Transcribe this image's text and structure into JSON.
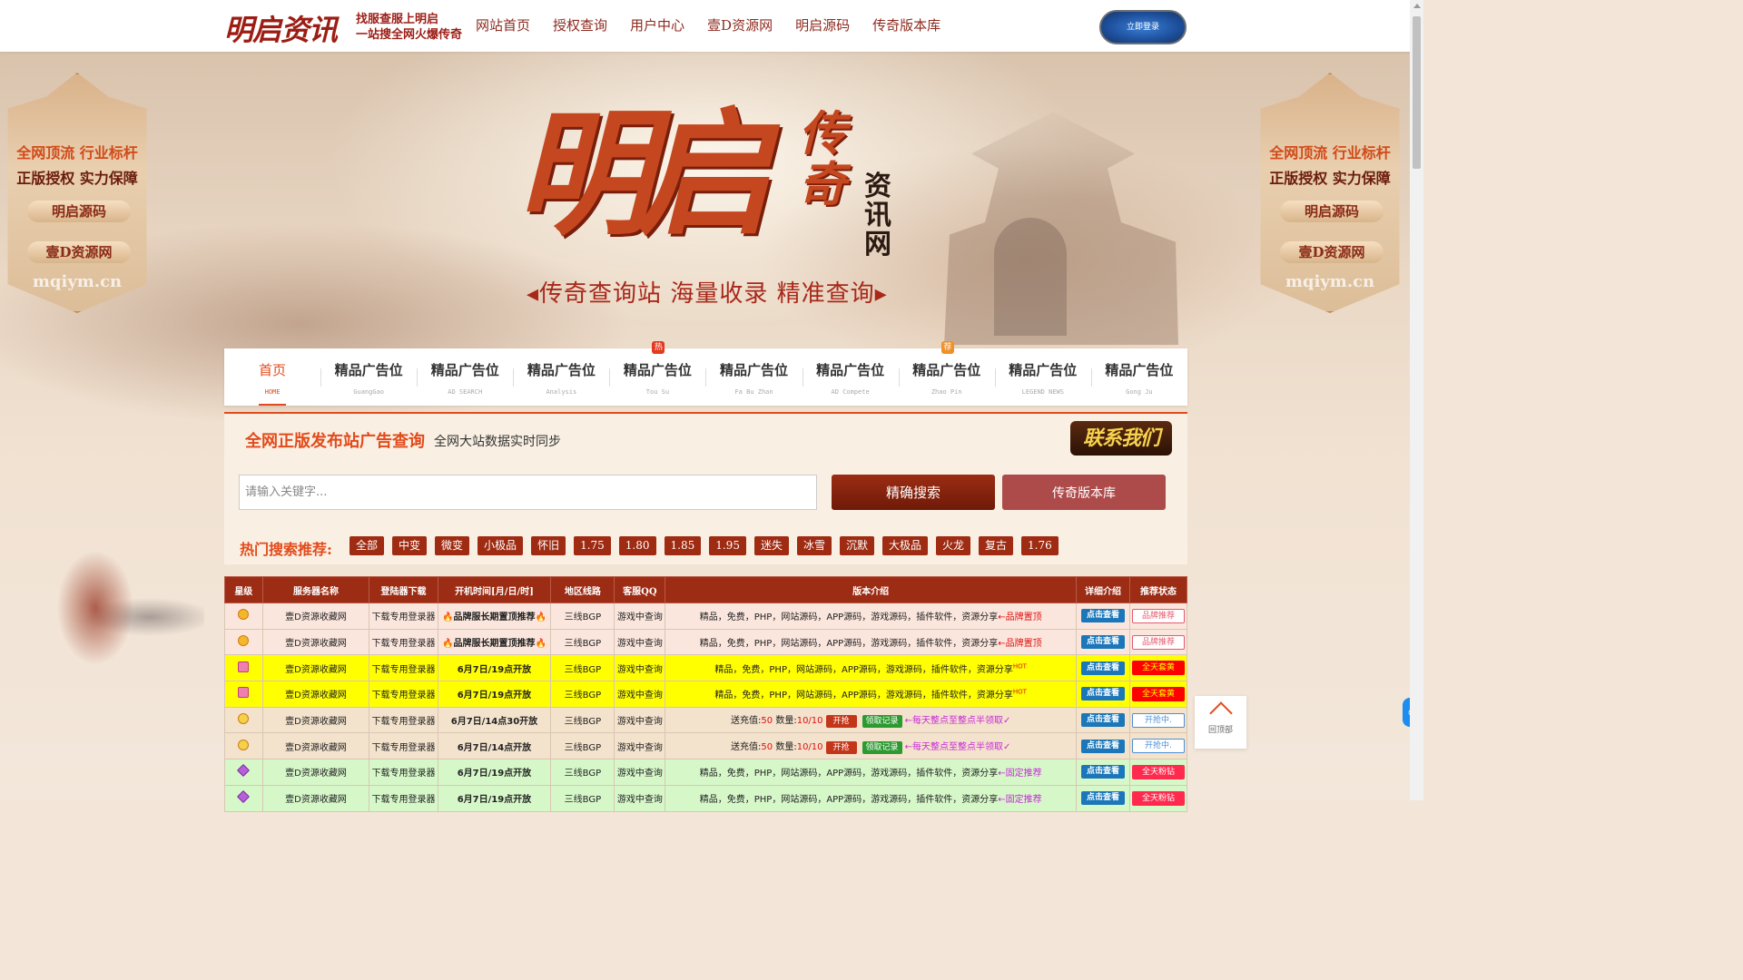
{
  "header": {
    "logo": "明启资讯",
    "tagline1": "找服查服上明启",
    "tagline2": "一站搜全网火爆传奇",
    "nav": [
      "网站首页",
      "授权查询",
      "用户中心",
      "壹D资源网",
      "明启源码",
      "传奇版本库"
    ],
    "login_label": "立即登录"
  },
  "side_banner": {
    "line1": "全网顶流 行业标杆",
    "line2": "正版授权 实力保障",
    "pill1": "明启源码",
    "pill2": "壹D资源网",
    "url": "mqiym.cn"
  },
  "hero": {
    "title": "明启",
    "title2": "传奇",
    "title3": "资讯网",
    "slogan": "◂传奇查询站 海量收录 精准查询▸"
  },
  "categories": [
    {
      "label": "首页",
      "sub": "HOME",
      "active": true,
      "badge": ""
    },
    {
      "label": "精品广告位",
      "sub": "GuangGao",
      "badge": ""
    },
    {
      "label": "精品广告位",
      "sub": "AD SEARCH",
      "badge": ""
    },
    {
      "label": "精品广告位",
      "sub": "Analysis",
      "badge": ""
    },
    {
      "label": "精品广告位",
      "sub": "Tou Su",
      "badge": "热"
    },
    {
      "label": "精品广告位",
      "sub": "Fa Bu Zhan",
      "badge": ""
    },
    {
      "label": "精品广告位",
      "sub": "AD Compete",
      "badge": ""
    },
    {
      "label": "精品广告位",
      "sub": "Zhao Pin",
      "badge": "荐"
    },
    {
      "label": "精品广告位",
      "sub": "LEGEND NEWS",
      "badge": ""
    },
    {
      "label": "精品广告位",
      "sub": "Gong Ju",
      "badge": ""
    }
  ],
  "search": {
    "title": "全网正版发布站广告查询",
    "subtitle": "全网大站数据实时同步",
    "contact_label": "联系我们",
    "placeholder": "请输入关键字...",
    "search_label": "精确搜索",
    "library_label": "传奇版本库",
    "hot_label": "热门搜索推荐:",
    "hot_tags": [
      "全部",
      "中变",
      "微变",
      "小极品",
      "怀旧",
      "1.75",
      "1.80",
      "1.85",
      "1.95",
      "迷失",
      "冰雪",
      "沉默",
      "大极品",
      "火龙",
      "复古",
      "1.76"
    ]
  },
  "table": {
    "headers": [
      "星级",
      "服务器名称",
      "登陆器下载",
      "开机时间[月/日/时]",
      "地区线路",
      "客服QQ",
      "版本介绍",
      "详细介绍",
      "推荐状态"
    ],
    "rows": [
      {
        "style": "pink",
        "icon": "sun",
        "name": "壹D资源收藏网",
        "download": "下载专用登录器",
        "time": "🔥品牌服长期置顶推荐🔥",
        "time_style": "brand-red",
        "line": "三线BGP",
        "qq": "游戏中查询",
        "intro": "精品，免费，PHP，网站源码，APP源码，游戏源码，插件软件，资源分享",
        "tail": "←品牌置顶",
        "tail_style": "tail-red",
        "view": "点击查看",
        "status": "品牌推荐",
        "status_style": "st-brand"
      },
      {
        "style": "pink",
        "icon": "sun",
        "name": "壹D资源收藏网",
        "download": "下载专用登录器",
        "time": "🔥品牌服长期置顶推荐🔥",
        "time_style": "brand-red",
        "line": "三线BGP",
        "qq": "游戏中查询",
        "intro": "精品，免费，PHP，网站源码，APP源码，游戏源码，插件软件，资源分享",
        "tail": "←品牌置顶",
        "tail_style": "tail-red",
        "view": "点击查看",
        "status": "品牌推荐",
        "status_style": "st-brand"
      },
      {
        "style": "yellow",
        "icon": "crown",
        "name": "壹D资源收藏网",
        "download": "下载专用登录器",
        "time": "6月7日/19点开放",
        "time_style": "bold",
        "line": "三线BGP",
        "qq": "游戏中查询",
        "intro": "精品，免费，PHP，网站源码，APP源码，游戏源码，插件软件，资源分享",
        "tail": "HOT",
        "tail_style": "hot",
        "view": "点击查看",
        "status": "全天套黄",
        "status_style": "st-yellow"
      },
      {
        "style": "yellow",
        "icon": "crown",
        "name": "壹D资源收藏网",
        "download": "下载专用登录器",
        "time": "6月7日/19点开放",
        "time_style": "bold",
        "line": "三线BGP",
        "qq": "游戏中查询",
        "intro": "精品，免费，PHP，网站源码，APP源码，游戏源码，插件软件，资源分享",
        "tail": "HOT",
        "tail_style": "hot",
        "view": "点击查看",
        "status": "全天套黄",
        "status_style": "st-yellow"
      },
      {
        "style": "tan",
        "icon": "sad",
        "name": "壹D资源收藏网",
        "download": "下载专用登录器",
        "time": "6月7日/14点30开放",
        "time_style": "bold",
        "line": "三线BGP",
        "qq": "游戏中查询",
        "promo": true,
        "promo_prefix": "送充值:",
        "promo_val": "50",
        "promo_qty": "数量:",
        "promo_qty_val": "10/10",
        "promo_grab": "开抢",
        "promo_rec": "领取记录",
        "promo_hint": "←每天整点至整点半领取✓",
        "view": "点击查看",
        "status": "开抢中.",
        "status_style": "st-open"
      },
      {
        "style": "tan",
        "icon": "sad",
        "name": "壹D资源收藏网",
        "download": "下载专用登录器",
        "time": "6月7日/14点开放",
        "time_style": "bold",
        "line": "三线BGP",
        "qq": "游戏中查询",
        "promo": true,
        "promo_prefix": "送充值:",
        "promo_val": "50",
        "promo_qty": "数量:",
        "promo_qty_val": "10/10",
        "promo_grab": "开抢",
        "promo_rec": "领取记录",
        "promo_hint": "←每天整点至整点半领取✓",
        "view": "点击查看",
        "status": "开抢中.",
        "status_style": "st-open"
      },
      {
        "style": "green",
        "icon": "diamond",
        "name": "壹D资源收藏网",
        "download": "下载专用登录器",
        "time": "6月7日/19点开放",
        "time_style": "brand-mag",
        "line": "三线BGP",
        "qq": "游戏中查询",
        "intro": "精品，免费，PHP，网站源码，APP源码，游戏源码，插件软件，资源分享",
        "tail": "←固定推荐",
        "tail_style": "tail-mag",
        "view": "点击查看",
        "status": "全天粉钻",
        "status_style": "st-green"
      },
      {
        "style": "green",
        "icon": "diamond",
        "name": "壹D资源收藏网",
        "download": "下载专用登录器",
        "time": "6月7日/19点开放",
        "time_style": "brand-mag",
        "line": "三线BGP",
        "qq": "游戏中查询",
        "intro": "精品，免费，PHP，网站源码，APP源码，游戏源码，插件软件，资源分享",
        "tail": "←固定推荐",
        "tail_style": "tail-mag",
        "view": "点击查看",
        "status": "全天粉钻",
        "status_style": "st-green"
      }
    ]
  },
  "backtop_label": "回顶部"
}
